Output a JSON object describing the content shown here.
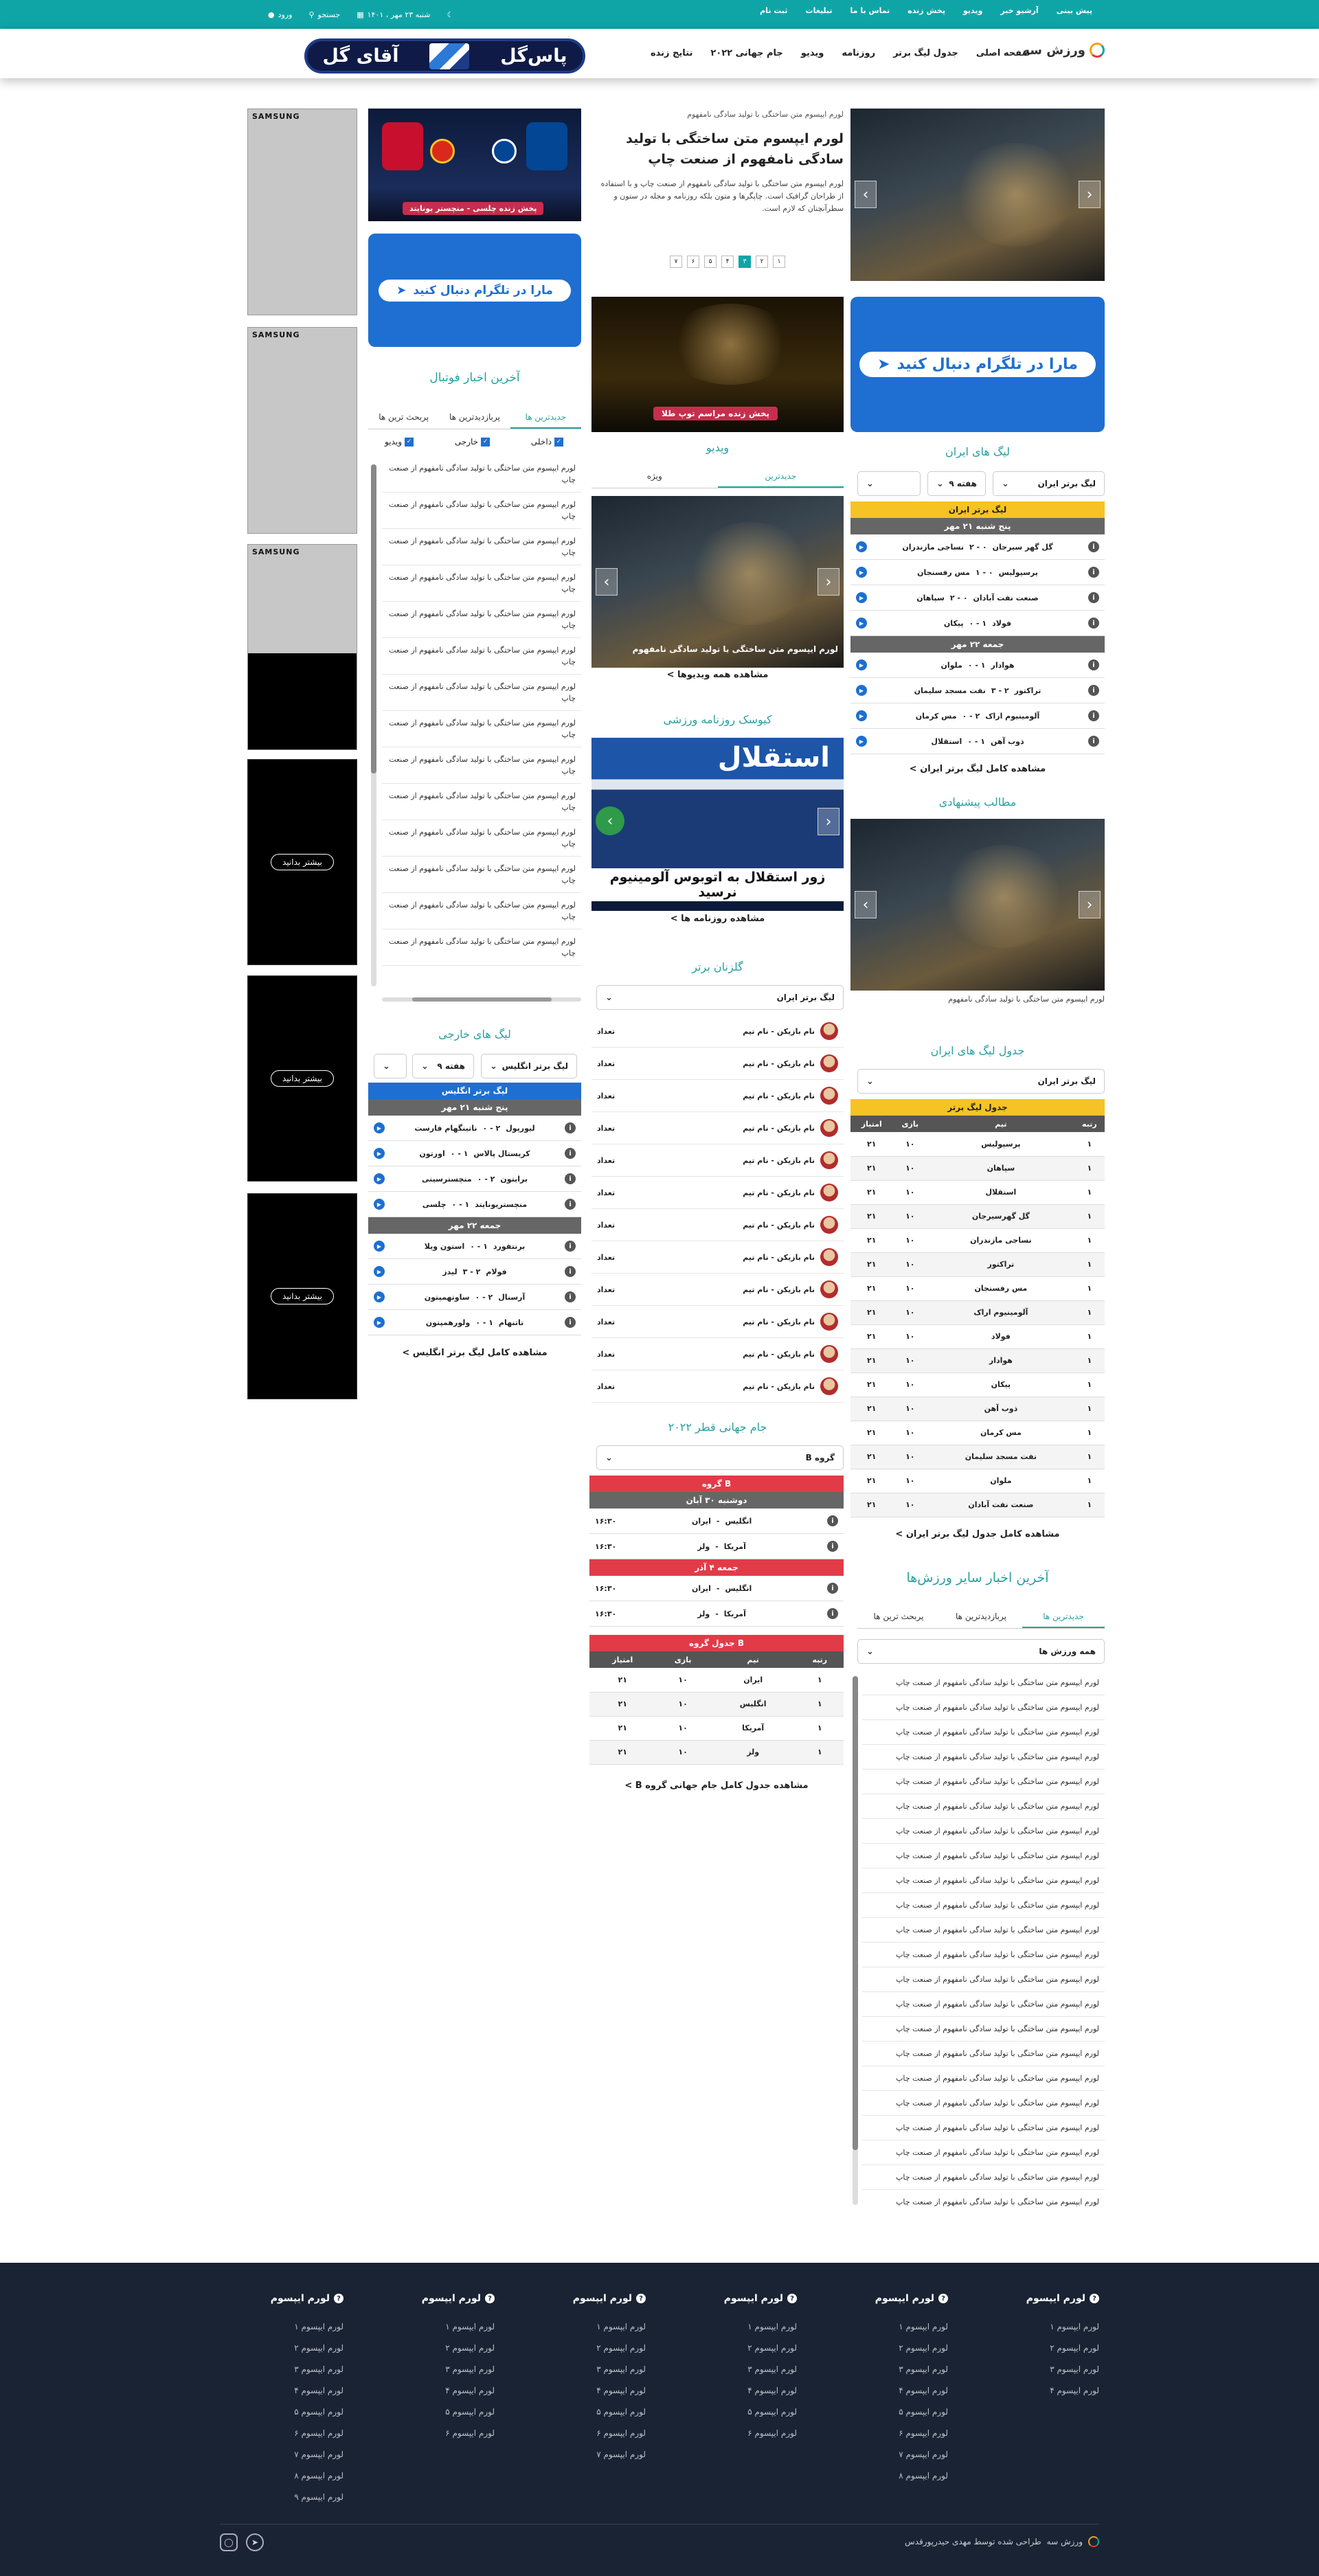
{
  "topbar": {
    "links": [
      "پیش بینی",
      "آرشیو خبر",
      "ویدیو",
      "پخش زنده",
      "تماس با ما",
      "تبلیغات",
      "ثبت نام"
    ],
    "date": "شنبه ۲۳ مهر ، ۱۴۰۱",
    "search_label": "جستجو",
    "login_label": "ورود"
  },
  "header": {
    "logo_text": "ورزش سه",
    "nav": [
      "صفحه اصلی",
      "جدول لیگ برتر",
      "روزنامه",
      "ویدیو",
      "جام جهانی ۲۰۲۲",
      "نتایج زنده"
    ],
    "ad_text_right": "پاس‌گل",
    "ad_text_left": "آقای گل"
  },
  "colors": {
    "teal": "#0fa5a7",
    "gold": "#f6c324",
    "blue": "#1e6fd1",
    "red": "#e23b48",
    "footer": "#1a2333"
  },
  "hero": {
    "kicker": "لورم ایپسوم متن ساختگی با تولید سادگی نامفهوم",
    "title": "لورم ایپسوم متن ساختگی با تولید سادگی نامفهوم از صنعت چاپ",
    "summary": "لورم ایپسوم متن ساختگی با تولید سادگی نامفهوم از صنعت چاپ و با استفاده از طراحان گرافیک است. چاپگرها و متون بلکه روزنامه و مجله در ستون و سطرآنچنان که لازم است.",
    "dots": [
      "۱",
      "۲",
      "۳",
      "۴",
      "۵",
      "۶",
      "۷"
    ],
    "active_dot": 4
  },
  "promo_top": {
    "caption": "پخش زنده چلسی - منچستر یونایتد"
  },
  "promo_mid": {
    "caption": "پخش زنده مراسم توپ طلا"
  },
  "telegram": {
    "label": "مارا در تلگرام دنبال کنید"
  },
  "iran_league": {
    "title": "لیگ های ایران",
    "league_select": "لیگ برتر ایران",
    "week_select": "هفته ۹",
    "head": "لیگ برتر ایران",
    "days": [
      {
        "label": "پنج شنبه ۲۱ مهر",
        "matches": [
          {
            "home": "گل گهر سیرجان",
            "score": "۰ - ۲",
            "away": "نساجی مازندران"
          },
          {
            "home": "پرسپولیس",
            "score": "۰ - ۱",
            "away": "مس رفسنجان"
          },
          {
            "home": "صنعت نفت آبادان",
            "score": "۰ - ۲",
            "away": "سپاهان"
          },
          {
            "home": "فولاد",
            "score": "۱ - ۰",
            "away": "پیکان"
          }
        ]
      },
      {
        "label": "جمعه ۲۲ مهر",
        "matches": [
          {
            "home": "هوادار",
            "score": "۱ - ۰",
            "away": "ملوان"
          },
          {
            "home": "تراکتور",
            "score": "۲ - ۳",
            "away": "نفت مسجد سلیمان"
          },
          {
            "home": "آلومینیوم اراک",
            "score": "۲ - ۰",
            "away": "مس کرمان"
          },
          {
            "home": "ذوب آهن",
            "score": "۱ - ۰",
            "away": "استقلال"
          }
        ]
      }
    ],
    "more": "مشاهده کامل لیگ برتر ایران >"
  },
  "suggested": {
    "title": "مطالب پیشنهادی",
    "caption": "لورم ایپسوم متن ساختگی با تولید سادگی نامفهوم"
  },
  "iran_table": {
    "title": "جدول لیگ های ایران",
    "select": "لیگ برتر ایران",
    "head": "جدول لیگ برتر",
    "columns": [
      "رتبه",
      "تیم",
      "بازی",
      "امتیاز"
    ],
    "rows": [
      [
        "۱",
        "پرسپولیس",
        "۱۰",
        "۲۱"
      ],
      [
        "۱",
        "سپاهان",
        "۱۰",
        "۲۱"
      ],
      [
        "۱",
        "استقلال",
        "۱۰",
        "۲۱"
      ],
      [
        "۱",
        "گل گهرسیرجان",
        "۱۰",
        "۲۱"
      ],
      [
        "۱",
        "نساجی مازندران",
        "۱۰",
        "۲۱"
      ],
      [
        "۱",
        "تراکتور",
        "۱۰",
        "۲۱"
      ],
      [
        "۱",
        "مس رفسنجان",
        "۱۰",
        "۲۱"
      ],
      [
        "۱",
        "آلومینیوم اراک",
        "۱۰",
        "۲۱"
      ],
      [
        "۱",
        "فولاد",
        "۱۰",
        "۲۱"
      ],
      [
        "۱",
        "هوادار",
        "۱۰",
        "۲۱"
      ],
      [
        "۱",
        "پیکان",
        "۱۰",
        "۲۱"
      ],
      [
        "۱",
        "ذوب آهن",
        "۱۰",
        "۲۱"
      ],
      [
        "۱",
        "مس کرمان",
        "۱۰",
        "۲۱"
      ],
      [
        "۱",
        "نفت مسجد سلیمان",
        "۱۰",
        "۲۱"
      ],
      [
        "۱",
        "ملوان",
        "۱۰",
        "۲۱"
      ],
      [
        "۱",
        "صنعت نفت آبادان",
        "۱۰",
        "۲۱"
      ]
    ],
    "more": "مشاهده کامل جدول لیگ برتر ایران >"
  },
  "other_sports": {
    "title": "آخرین اخبار سایر ورزش‌ها",
    "tabs": [
      "جدیدترین ها",
      "پربازدیدترین ها",
      "پربحث ترین ها"
    ],
    "select": "همه ورزش ها",
    "item": "لورم ایپسوم متن ساختگی با تولید سادگی نامفهوم از صنعت چاپ"
  },
  "video": {
    "title": "ویدیو",
    "tabs": [
      "جدیدترین",
      "ویژه"
    ],
    "caption": "لورم ایپسوم متن ساختگی با تولید سادگی نامفهوم",
    "more": "مشاهده همه ویدیوها >"
  },
  "press": {
    "title": "کیوسک روزنامه ورزشی",
    "masthead": "استقلال",
    "headline": "زور استقلال به اتوبوس آلومینیوم نرسید",
    "more": "مشاهده روزنامه ها >"
  },
  "scorers": {
    "title": "گلزنان برتر",
    "select": "لیگ برتر ایران",
    "player": "نام بازیکن - نام تیم",
    "count_label": "تعداد"
  },
  "world_cup": {
    "title": "جام جهانی قطر ۲۰۲۲",
    "select": "گروه B",
    "group_head": "گروه B",
    "days": [
      {
        "label": "دوشنبه ۳۰ آبان",
        "matches": [
          {
            "home": "انگلیس",
            "away": "ایران",
            "time": "۱۶:۳۰"
          },
          {
            "home": "آمریکا",
            "away": "ولز",
            "time": "۱۶:۳۰"
          }
        ]
      },
      {
        "label": "جمعه ۴ آذر",
        "matches": [
          {
            "home": "انگلیس",
            "away": "ایران",
            "time": "۱۶:۳۰"
          },
          {
            "home": "آمریکا",
            "away": "ولز",
            "time": "۱۶:۳۰"
          }
        ]
      }
    ],
    "table_head": "جدول گروه B",
    "columns": [
      "رتبه",
      "تیم",
      "بازی",
      "امتیاز"
    ],
    "rows": [
      [
        "۱",
        "ایران",
        "۱۰",
        "۲۱"
      ],
      [
        "۱",
        "انگلیس",
        "۱۰",
        "۲۱"
      ],
      [
        "۱",
        "آمریکا",
        "۱۰",
        "۲۱"
      ],
      [
        "۱",
        "ولز",
        "۱۰",
        "۲۱"
      ]
    ],
    "more": "مشاهده جدول کامل جام جهانی گروه B >"
  },
  "football_news": {
    "title": "آخرین اخبار فوتبال",
    "tabs": [
      "جدیدترین ها",
      "پربازدیدترین ها",
      "پربحث ترین ها"
    ],
    "filters": [
      "داخلی",
      "خارجی",
      "ویدیو"
    ],
    "item": "لورم ایپسوم متن ساختگی با تولید سادگی نامفهوم از صنعت چاپ"
  },
  "foreign_league": {
    "title": "لیگ های خارجی",
    "league_select": "لیگ برتر انگلیس",
    "week_select": "هفته ۹",
    "head": "لیگ برتر انگلیس",
    "days": [
      {
        "label": "پنج شنبه ۲۱ مهر",
        "matches": [
          {
            "home": "لیورپول",
            "score": "۲ - ۰",
            "away": "ناتینگهام فارست"
          },
          {
            "home": "کریستال پالاس",
            "score": "۱ - ۰",
            "away": "اورتون"
          },
          {
            "home": "برایتون",
            "score": "۲ - ۰",
            "away": "منچسترسیتی"
          },
          {
            "home": "منچستریونایتد",
            "score": "۱ - ۰",
            "away": "چلسی"
          }
        ]
      },
      {
        "label": "جمعه ۲۲ مهر",
        "matches": [
          {
            "home": "برنتفورد",
            "score": "۱ - ۰",
            "away": "استون ویلا"
          },
          {
            "home": "فولام",
            "score": "۲ - ۳",
            "away": "لیدز"
          },
          {
            "home": "آرسنال",
            "score": "۲ - ۰",
            "away": "ساوتهمپتون"
          },
          {
            "home": "تاتنهام",
            "score": "۱ - ۰",
            "away": "ولورهمپتون"
          }
        ]
      }
    ],
    "more": "مشاهده کامل لیگ برتر انگلیس >"
  },
  "ads": {
    "brand": "SAMSUNG",
    "cta": "بیشتر بدانید"
  },
  "footer": {
    "col_title": "لورم ایپسوم",
    "columns": [
      [
        "لورم ایپسوم ۱",
        "لورم ایپسوم ۲",
        "لورم ایپسوم ۳",
        "لورم ایپسوم ۴"
      ],
      [
        "لورم ایپسوم ۱",
        "لورم ایپسوم ۲",
        "لورم ایپسوم ۳",
        "لورم ایپسوم ۴",
        "لورم ایپسوم ۵",
        "لورم ایپسوم ۶",
        "لورم ایپسوم ۷",
        "لورم ایپسوم ۸"
      ],
      [
        "لورم ایپسوم ۱",
        "لورم ایپسوم ۲",
        "لورم ایپسوم ۳",
        "لورم ایپسوم ۴",
        "لورم ایپسوم ۵",
        "لورم ایپسوم ۶"
      ],
      [
        "لورم ایپسوم ۱",
        "لورم ایپسوم ۲",
        "لورم ایپسوم ۳",
        "لورم ایپسوم ۴",
        "لورم ایپسوم ۵",
        "لورم ایپسوم ۶",
        "لورم ایپسوم ۷"
      ],
      [
        "لورم ایپسوم ۱",
        "لورم ایپسوم ۲",
        "لورم ایپسوم ۳",
        "لورم ایپسوم ۴",
        "لورم ایپسوم ۵",
        "لورم ایپسوم ۶"
      ],
      [
        "لورم ایپسوم ۱",
        "لورم ایپسوم ۲",
        "لورم ایپسوم ۳",
        "لورم ایپسوم ۴",
        "لورم ایپسوم ۵",
        "لورم ایپسوم ۶",
        "لورم ایپسوم ۷",
        "لورم ایپسوم ۸",
        "لورم ایپسوم ۹"
      ]
    ],
    "copyright_brand": "ورزش سه",
    "copyright": "طراحی شده توسط مهدی حیدرپورقدس"
  }
}
